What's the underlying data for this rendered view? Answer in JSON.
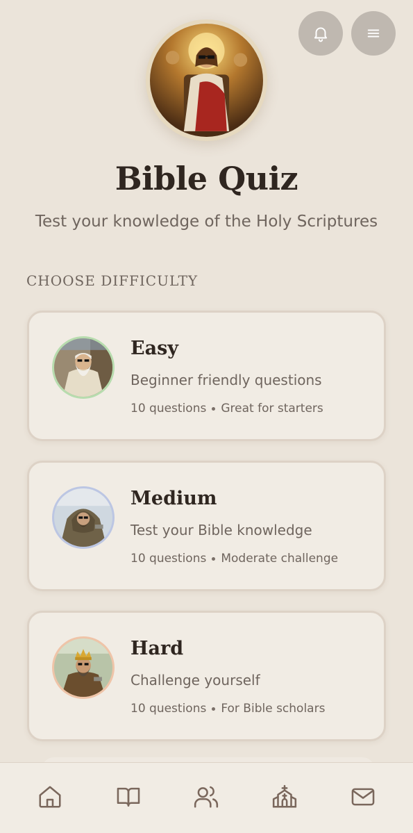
{
  "app": {
    "title": "Bible Quiz",
    "subtitle": "Test your knowledge of the Holy Scriptures"
  },
  "header": {
    "icons": [
      "bell-icon",
      "menu-icon"
    ]
  },
  "section": {
    "label": "CHOOSE DIFFICULTY"
  },
  "difficulties": [
    {
      "title": "Easy",
      "description": "Beginner friendly questions",
      "questions": "10 questions",
      "note": "Great for starters",
      "ring_color": "#b7dcae"
    },
    {
      "title": "Medium",
      "description": "Test your Bible knowledge",
      "questions": "10 questions",
      "note": "Moderate challenge",
      "ring_color": "#bcc6e3"
    },
    {
      "title": "Hard",
      "description": "Challenge yourself",
      "questions": "10 questions",
      "note": "For Bible scholars",
      "ring_color": "#efc4a8"
    }
  ],
  "bottom_nav": {
    "items": [
      "home-icon",
      "book-icon",
      "users-icon",
      "church-icon",
      "mail-icon"
    ]
  },
  "colors": {
    "background": "#ebe4da",
    "card": "#f1ece4",
    "card_border": "#ddd2c6",
    "title": "#2f2620",
    "muted_text": "#6f655e",
    "icon": "#7a675c"
  }
}
